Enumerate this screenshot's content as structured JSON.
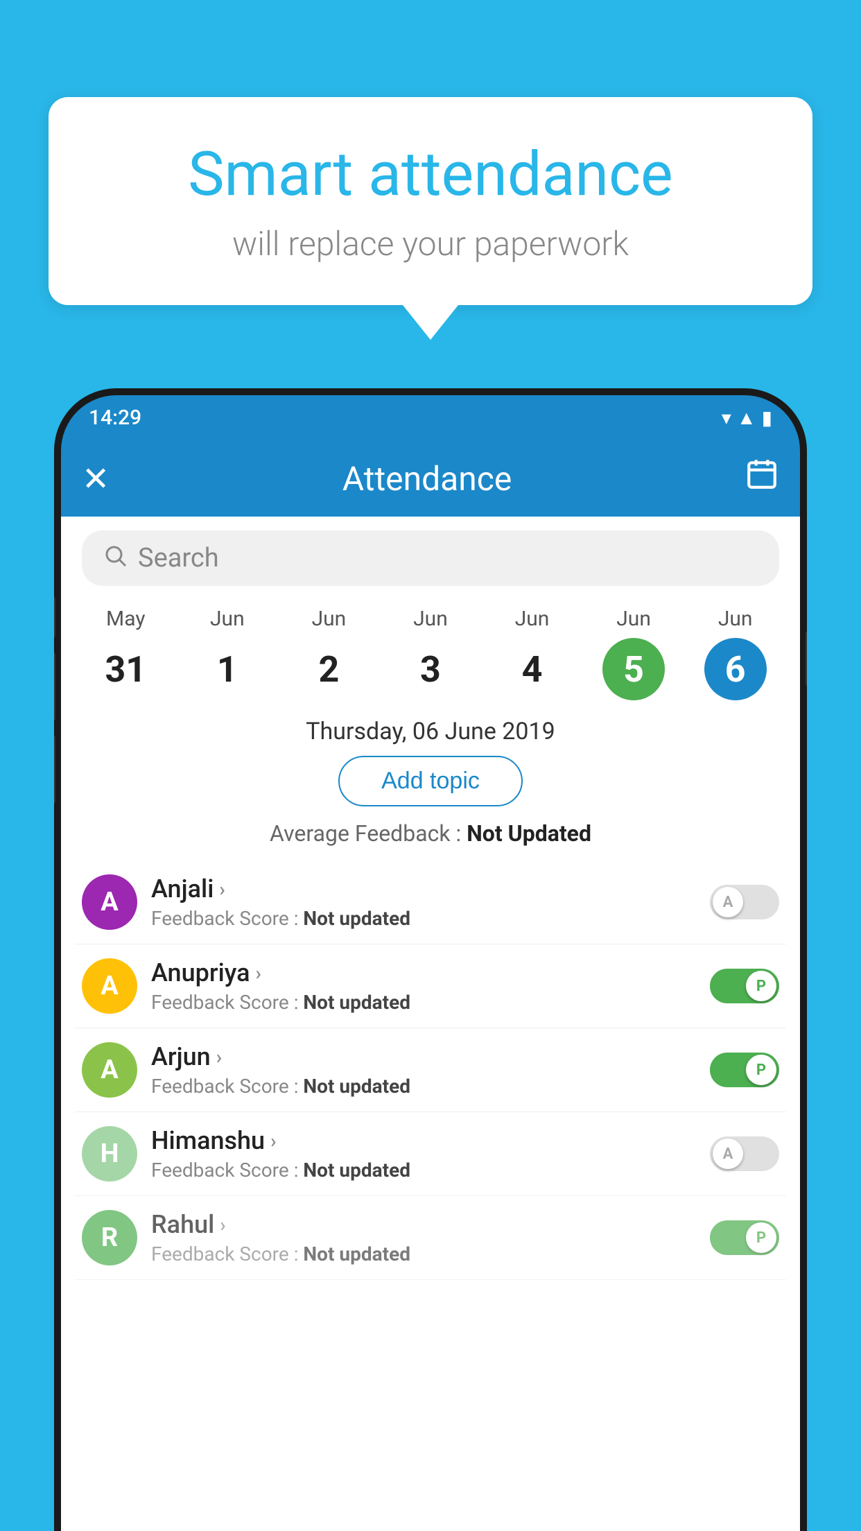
{
  "background_color": "#29b6e8",
  "speech_bubble": {
    "title": "Smart attendance",
    "subtitle": "will replace your paperwork"
  },
  "status_bar": {
    "time": "14:29",
    "icons": [
      "wifi",
      "signal",
      "battery"
    ]
  },
  "app_bar": {
    "title": "Attendance",
    "close_icon": "✕",
    "calendar_icon": "📅"
  },
  "search": {
    "placeholder": "Search"
  },
  "calendar": {
    "days": [
      {
        "month": "May",
        "date": "31",
        "style": "normal"
      },
      {
        "month": "Jun",
        "date": "1",
        "style": "normal"
      },
      {
        "month": "Jun",
        "date": "2",
        "style": "normal"
      },
      {
        "month": "Jun",
        "date": "3",
        "style": "normal"
      },
      {
        "month": "Jun",
        "date": "4",
        "style": "normal"
      },
      {
        "month": "Jun",
        "date": "5",
        "style": "today"
      },
      {
        "month": "Jun",
        "date": "6",
        "style": "selected"
      }
    ]
  },
  "selected_date_label": "Thursday, 06 June 2019",
  "add_topic_label": "Add topic",
  "avg_feedback_label": "Average Feedback : ",
  "avg_feedback_value": "Not Updated",
  "students": [
    {
      "name": "Anjali",
      "initial": "A",
      "avatar_color": "#9c27b0",
      "feedback_label": "Feedback Score : ",
      "feedback_value": "Not updated",
      "toggle_state": "off",
      "toggle_label": "A"
    },
    {
      "name": "Anupriya",
      "initial": "A",
      "avatar_color": "#ffc107",
      "feedback_label": "Feedback Score : ",
      "feedback_value": "Not updated",
      "toggle_state": "on",
      "toggle_label": "P"
    },
    {
      "name": "Arjun",
      "initial": "A",
      "avatar_color": "#8bc34a",
      "feedback_label": "Feedback Score : ",
      "feedback_value": "Not updated",
      "toggle_state": "on",
      "toggle_label": "P"
    },
    {
      "name": "Himanshu",
      "initial": "H",
      "avatar_color": "#a5d6a7",
      "feedback_label": "Feedback Score : ",
      "feedback_value": "Not updated",
      "toggle_state": "off",
      "toggle_label": "A"
    },
    {
      "name": "Rahul",
      "initial": "R",
      "avatar_color": "#4caf50",
      "feedback_label": "Feedback Score : ",
      "feedback_value": "Not updated",
      "toggle_state": "on",
      "toggle_label": "P"
    }
  ]
}
